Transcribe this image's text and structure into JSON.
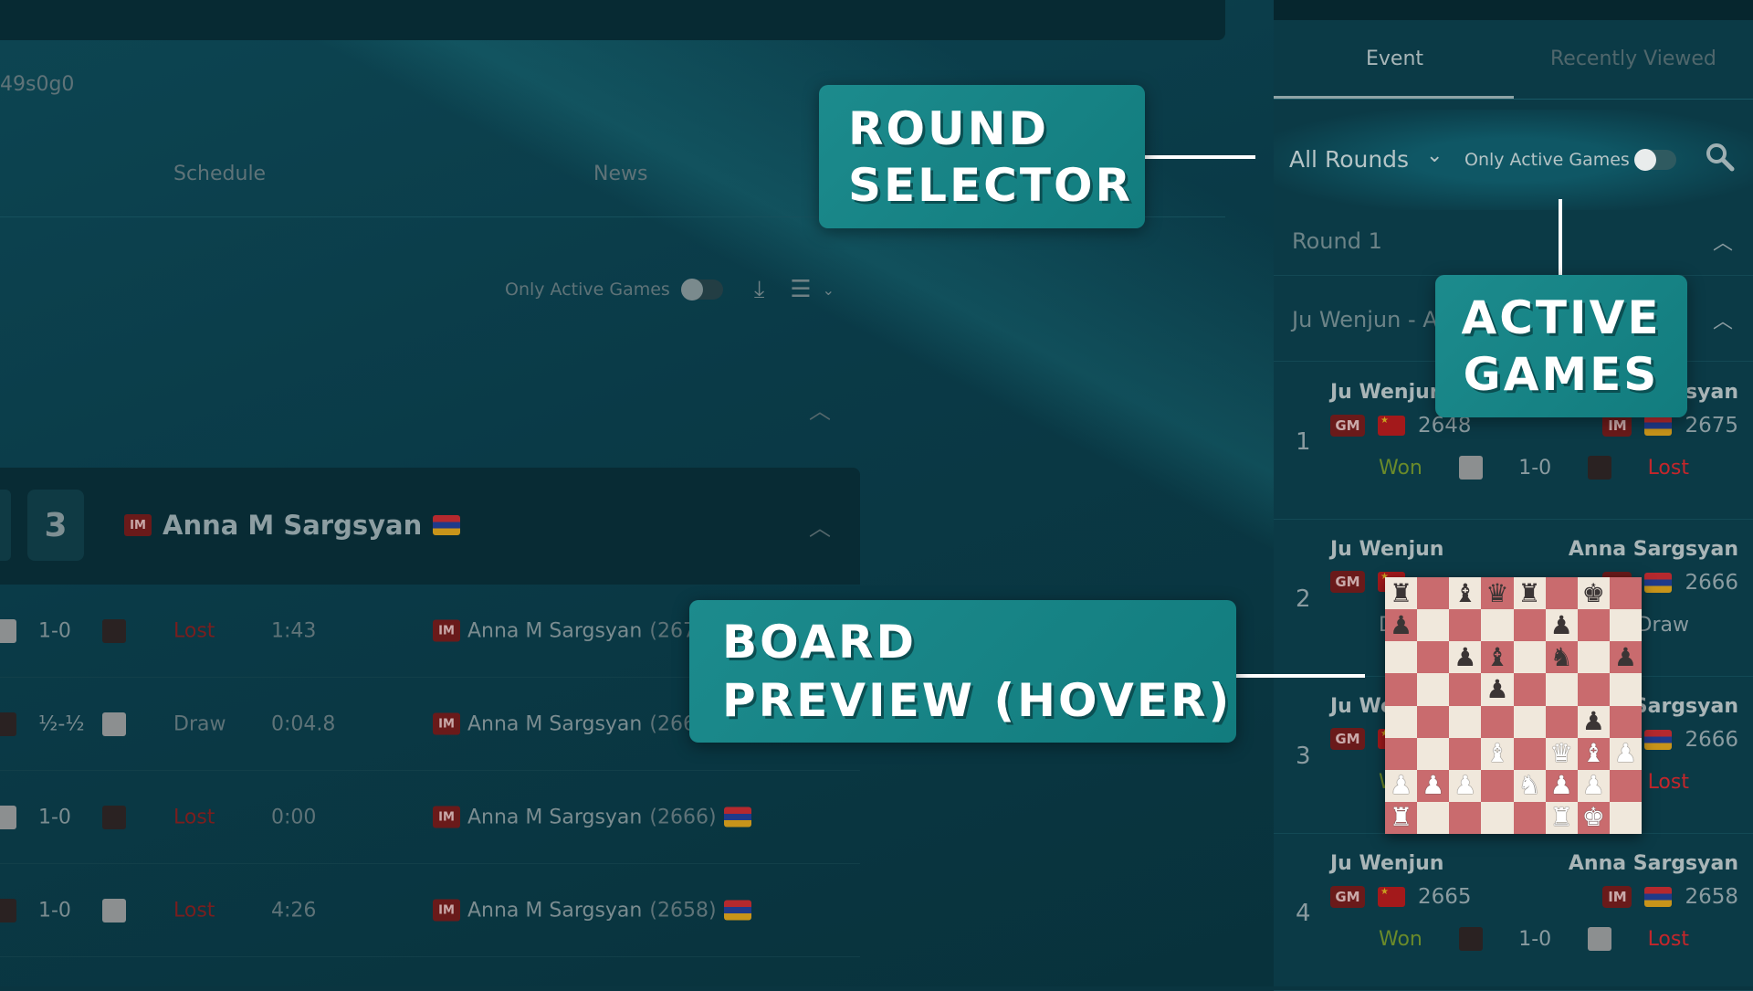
{
  "left": {
    "event_id": "49s0g0",
    "tabs": [
      "Schedule",
      "News"
    ],
    "toolbar": {
      "only_active_label": "Only Active Games",
      "download_icon": "download-icon",
      "layout_icon": "list-icon"
    },
    "player": {
      "round_no": "3",
      "title": "IM",
      "name": "Anna M Sargsyan",
      "flag": "armenia"
    },
    "rows": [
      {
        "c1": "white",
        "score": "1-0",
        "c2": "black",
        "result": "Lost",
        "time": "1:43",
        "title": "IM",
        "opponent": "Anna M Sargsyan",
        "rating": "(2675)"
      },
      {
        "c1": "black",
        "score": "½-½",
        "c2": "white",
        "result": "Draw",
        "time": "0:04.8",
        "title": "IM",
        "opponent": "Anna M Sargsyan",
        "rating": "(2666)"
      },
      {
        "c1": "white",
        "score": "1-0",
        "c2": "black",
        "result": "Lost",
        "time": "0:00",
        "title": "IM",
        "opponent": "Anna M Sargsyan",
        "rating": "(2666)"
      },
      {
        "c1": "black",
        "score": "1-0",
        "c2": "white",
        "result": "Lost",
        "time": "4:26",
        "title": "IM",
        "opponent": "Anna M Sargsyan",
        "rating": "(2658)"
      }
    ]
  },
  "right": {
    "tabs": {
      "event": "Event",
      "recent": "Recently Viewed"
    },
    "round_select": "All Rounds",
    "only_active_label": "Only Active Games",
    "only_active_on": false,
    "round_header": "Round 1",
    "match_header": "Ju Wenjun - Anna Sargsyan",
    "games": [
      {
        "no": "1",
        "white": "Ju Wenjun",
        "wtitle": "GM",
        "wrating": "2648",
        "black": "Anna Sargsyan",
        "btitle": "IM",
        "brating": "2675",
        "wres": "Won",
        "score": "1-0",
        "bres": "Lost"
      },
      {
        "no": "2",
        "white": "Ju Wenjun",
        "wtitle": "GM",
        "wrating": "",
        "black": "Anna Sargsyan",
        "btitle": "IM",
        "brating": "2666",
        "wres": "Draw",
        "score": "",
        "bres": "Draw"
      },
      {
        "no": "3",
        "white": "Ju Wenjun",
        "wtitle": "GM",
        "wrating": "",
        "black": "Anna Sargsyan",
        "btitle": "IM",
        "brating": "2666",
        "wres": "Won",
        "score": "",
        "bres": "Lost"
      },
      {
        "no": "4",
        "white": "Ju Wenjun",
        "wtitle": "GM",
        "wrating": "2665",
        "black": "Anna Sargsyan",
        "btitle": "IM",
        "brating": "2658",
        "wres": "Won",
        "score": "1-0",
        "bres": "Lost"
      }
    ]
  },
  "board_preview": [
    "r.bqr.k.",
    "p....p..",
    "..pb.n.p",
    "...p....",
    "......p.",
    "...B.QBP",
    "PPP.NPP.",
    "R....RK."
  ],
  "callouts": {
    "round_selector": [
      "ROUND",
      "SELECTOR"
    ],
    "active_games": [
      "ACTIVE",
      "GAMES"
    ],
    "board_preview": [
      "BOARD",
      "PREVIEW (HOVER)"
    ]
  },
  "colors": {
    "accent": "#1c8b8d",
    "won": "#4a6a22",
    "lost": "#c4262b",
    "background": "#0a3540"
  }
}
